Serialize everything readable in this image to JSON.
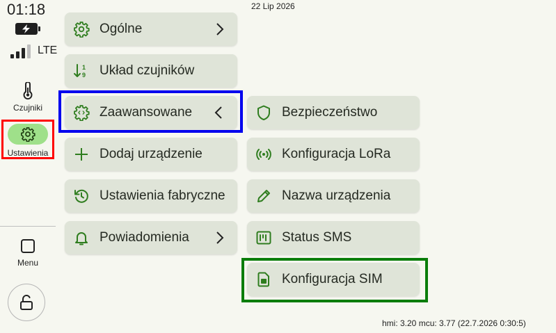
{
  "status": {
    "time": "01:18",
    "network": "LTE",
    "date": "22 Lip 2026"
  },
  "nav": {
    "sensors_label": "Czujniki",
    "settings_label": "Ustawienia",
    "menu_label": "Menu"
  },
  "menu_col1": [
    {
      "label": "Ogólne",
      "icon": "gear-icon",
      "chevron": "right"
    },
    {
      "label": "Układ czujników",
      "icon": "sort-icon"
    },
    {
      "label": "Zaawansowane",
      "icon": "advanced-gear-icon",
      "chevron": "left"
    },
    {
      "label": "Dodaj urządzenie",
      "icon": "plus-icon"
    },
    {
      "label": "Ustawienia fabryczne",
      "icon": "history-icon"
    },
    {
      "label": "Powiadomienia",
      "icon": "bell-icon",
      "chevron": "right"
    }
  ],
  "menu_col2": [
    {
      "label": "Bezpieczeństwo",
      "icon": "shield-icon"
    },
    {
      "label": "Konfiguracja LoRa",
      "icon": "radio-waves-icon"
    },
    {
      "label": "Nazwa urządzenia",
      "icon": "pencil-icon"
    },
    {
      "label": "Status SMS",
      "icon": "sms-status-icon"
    },
    {
      "label": "Konfiguracja SIM",
      "icon": "sim-card-icon"
    }
  ],
  "footer": {
    "version": "hmi: 3.20 mcu: 3.77 (22.7.2026 0:30:5)"
  },
  "colors": {
    "accent": "#2f7d1f",
    "button_bg": "#dfe4d8",
    "selected_pill": "#9fe08a",
    "highlight_red": "#ff0000",
    "highlight_blue": "#0000ee",
    "highlight_green": "#0a7d0a"
  }
}
